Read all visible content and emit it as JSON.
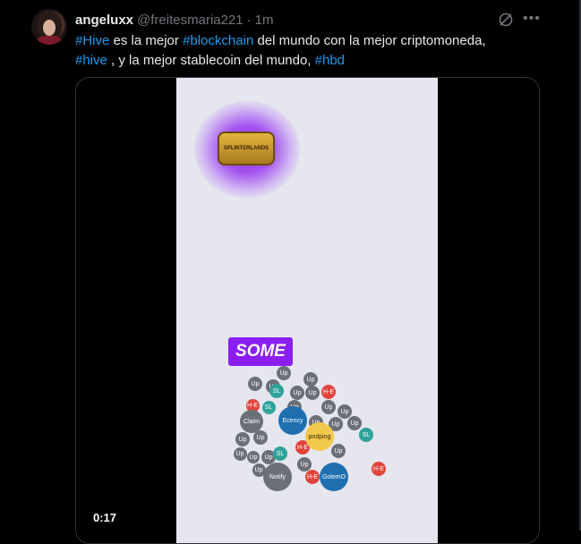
{
  "author": {
    "name": "angeluxx",
    "handle": "@freitesmaria221",
    "separator": "·",
    "time": "1m"
  },
  "tweet": {
    "tag1": "#Hive",
    "text1": " es la mejor ",
    "tag2": "#blockchain",
    "text2": " del mundo con la mejor criptomoneda, ",
    "tag3": "#hive",
    "text3": " , y la mejor stablecoin del mundo, ",
    "tag4": "#hbd"
  },
  "media": {
    "timestamp": "0:17",
    "logo_text": "SPLINTERLANDS",
    "banner_text": "SOME",
    "bubbles": [
      {
        "label": "Up",
        "color": "gray"
      },
      {
        "label": "Up",
        "color": "gray"
      },
      {
        "label": "Up",
        "color": "gray"
      },
      {
        "label": "Up",
        "color": "gray"
      },
      {
        "label": "SL",
        "color": "teal"
      },
      {
        "label": "Up",
        "color": "gray"
      },
      {
        "label": "Up",
        "color": "gray"
      },
      {
        "label": "H-E",
        "color": "red"
      },
      {
        "label": "H-E",
        "color": "red"
      },
      {
        "label": "SL",
        "color": "teal"
      },
      {
        "label": "Up",
        "color": "gray"
      },
      {
        "label": "Up",
        "color": "gray"
      },
      {
        "label": "Up",
        "color": "gray"
      },
      {
        "label": "Claim",
        "color": "gray"
      },
      {
        "label": "Ecency",
        "color": "blue"
      },
      {
        "label": "Up",
        "color": "gray"
      },
      {
        "label": "Up",
        "color": "gray"
      },
      {
        "label": "Up",
        "color": "gray"
      },
      {
        "label": "Up",
        "color": "gray"
      },
      {
        "label": "Up",
        "color": "gray"
      },
      {
        "label": "SL",
        "color": "teal"
      },
      {
        "label": "Up",
        "color": "gray"
      },
      {
        "label": "H-E",
        "color": "red"
      },
      {
        "label": "podping",
        "color": "yellow"
      },
      {
        "label": "Up",
        "color": "gray"
      },
      {
        "label": "Up",
        "color": "gray"
      },
      {
        "label": "SL",
        "color": "teal"
      },
      {
        "label": "Up",
        "color": "gray"
      },
      {
        "label": "Up",
        "color": "gray"
      },
      {
        "label": "Notify",
        "color": "gray"
      },
      {
        "label": "H-E",
        "color": "red"
      },
      {
        "label": "GolemO",
        "color": "blue"
      },
      {
        "label": "H-E",
        "color": "red"
      },
      {
        "label": "Up",
        "color": "gray"
      },
      {
        "label": "Up",
        "color": "gray"
      }
    ]
  },
  "icons": {
    "grok": "grok-icon",
    "more": "more-icon"
  }
}
